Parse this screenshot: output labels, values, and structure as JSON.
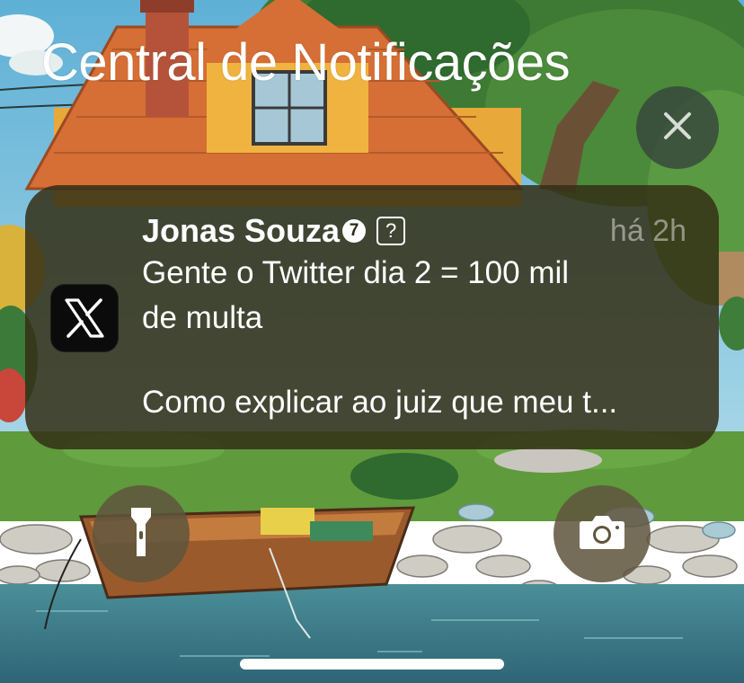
{
  "header": {
    "title": "Central de Notificações"
  },
  "notification": {
    "app": "X",
    "sender": "Jonas Souza",
    "sender_badge": "7",
    "sender_box": "?",
    "time": "há 2h",
    "line1": "Gente o Twitter dia 2 = 100 mil",
    "line2": "de multa",
    "line3": "Como explicar ao juiz que meu t..."
  },
  "icons": {
    "clear": "close-icon",
    "flashlight": "flashlight-icon",
    "camera": "camera-icon"
  },
  "colors": {
    "card": "#34301a",
    "sky": "#6db8d8",
    "roof": "#d9773a",
    "water": "#3e7d8c"
  }
}
